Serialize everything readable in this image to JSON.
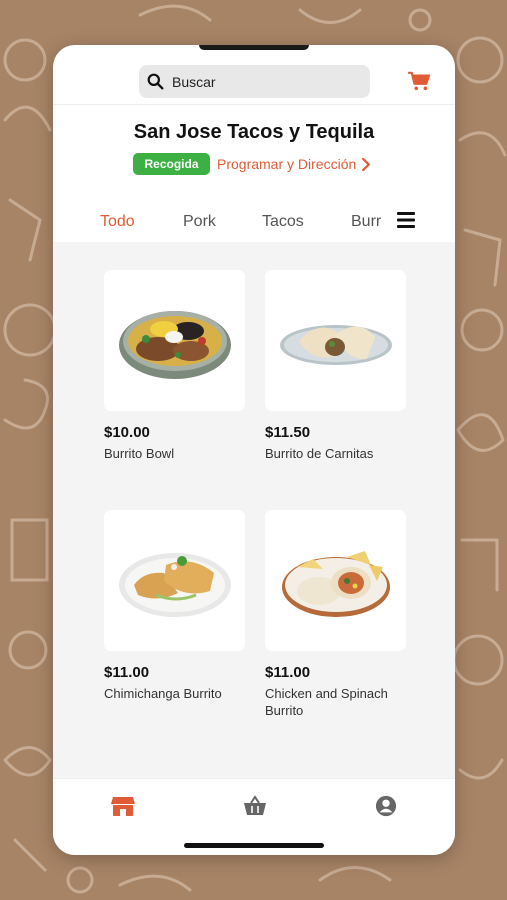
{
  "search": {
    "placeholder": "Buscar",
    "icon": "search-icon"
  },
  "header": {
    "cart_icon": "cart-icon",
    "restaurant_name": "San Jose Tacos y Tequila",
    "mode_badge": "Recogida",
    "schedule_link": "Programar y Dirección"
  },
  "tabs": [
    {
      "label": "Todo",
      "active": true
    },
    {
      "label": "Pork",
      "active": false
    },
    {
      "label": "Tacos",
      "active": false
    },
    {
      "label": "Burr",
      "active": false
    }
  ],
  "menu_icon": "hamburger-menu-icon",
  "products": [
    {
      "price": "$10.00",
      "name": "Burrito Bowl"
    },
    {
      "price": "$11.50",
      "name": "Burrito de Carnitas"
    },
    {
      "price": "$11.00",
      "name": "Chimichanga Burrito"
    },
    {
      "price": "$11.00",
      "name": "Chicken and Spinach Burrito"
    }
  ],
  "bottom_nav": [
    {
      "icon": "store-icon",
      "active": true
    },
    {
      "icon": "basket-icon",
      "active": false
    },
    {
      "icon": "account-icon",
      "active": false
    }
  ],
  "colors": {
    "accent": "#e05c36",
    "badge_green": "#3cb043",
    "background": "#a88466"
  }
}
